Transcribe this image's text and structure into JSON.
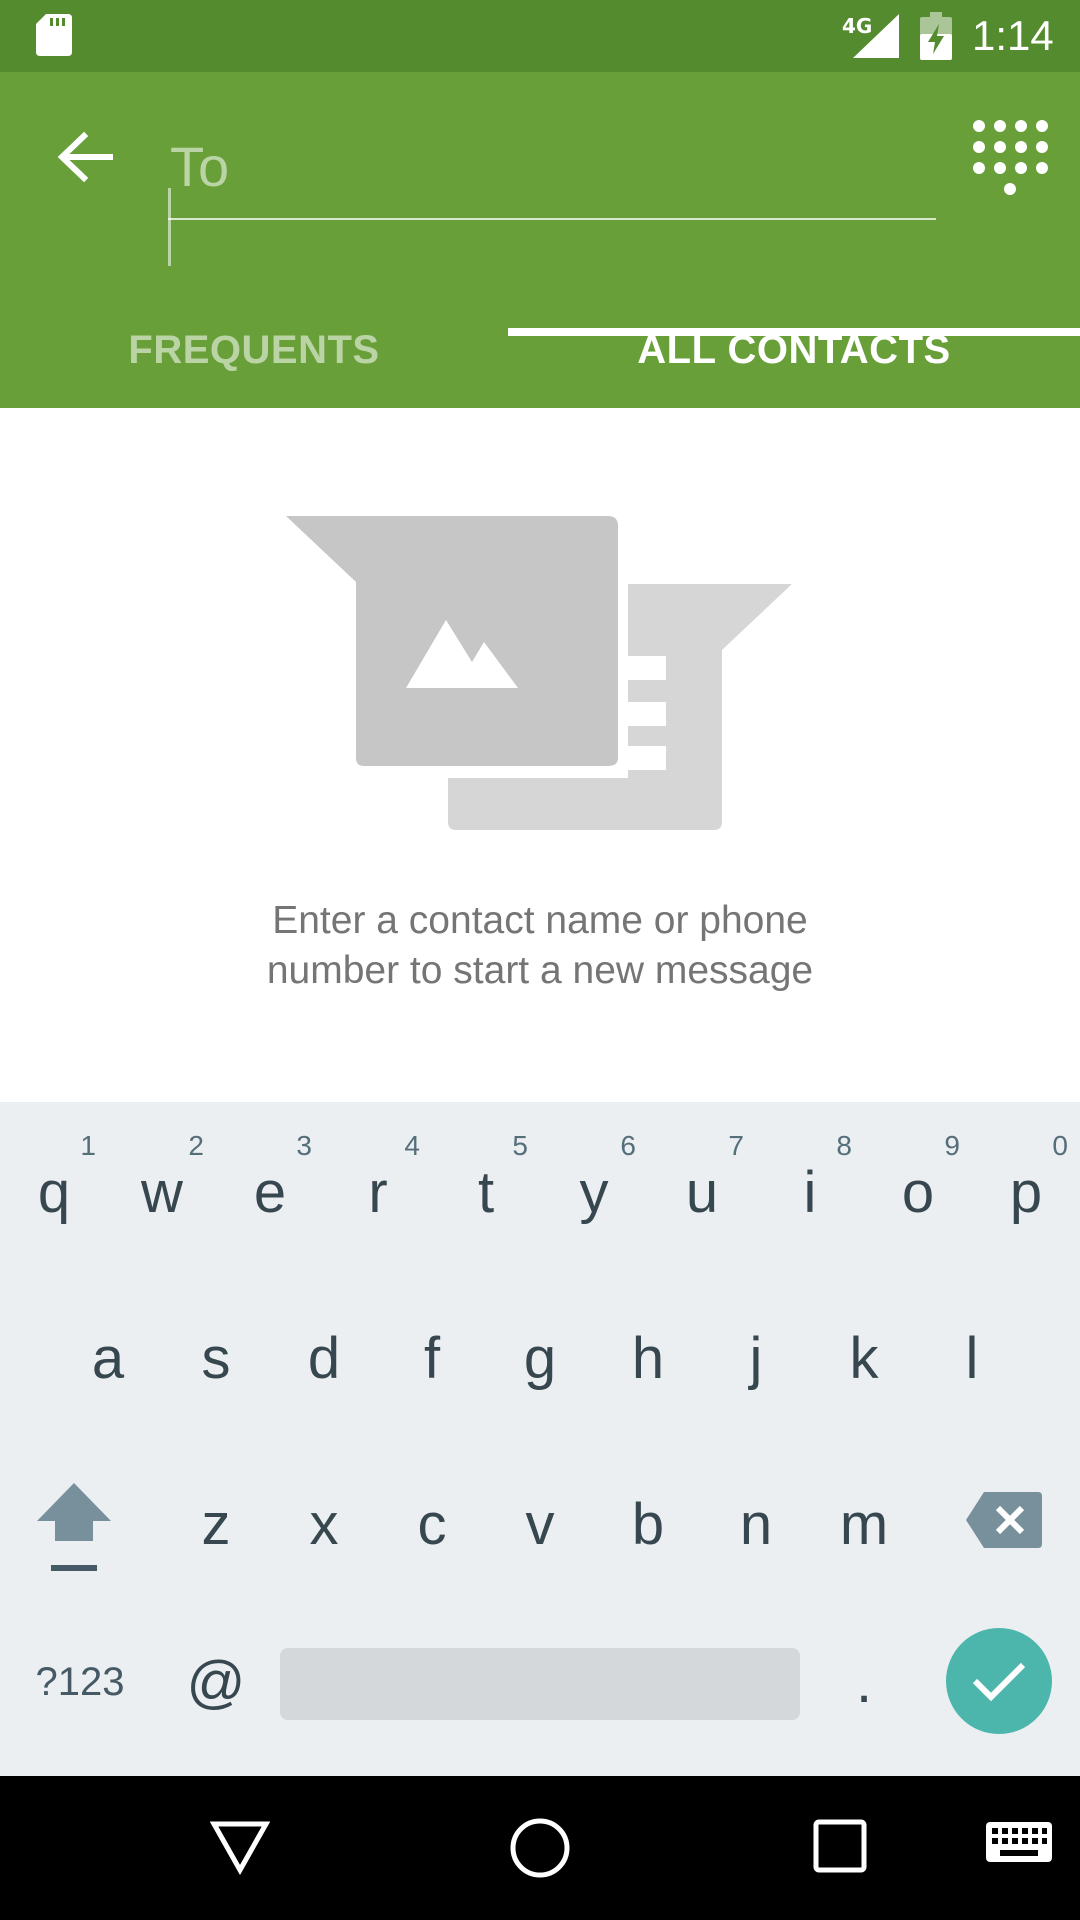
{
  "status_bar": {
    "network_type": "4G",
    "time": "1:14",
    "icons": [
      "sd-card-icon",
      "signal-icon",
      "battery-charging-icon"
    ]
  },
  "app_bar": {
    "back_icon": "arrow-back-icon",
    "to_placeholder": "To",
    "to_value": "",
    "dialpad_icon": "dialpad-icon",
    "background": "#689f38",
    "status_background": "#558b2f"
  },
  "tabs": [
    {
      "label": "FREQUENTS",
      "selected": false
    },
    {
      "label": "ALL CONTACTS",
      "selected": true
    }
  ],
  "empty_state": {
    "icon": "messages-illustration-icon",
    "message_line1": "Enter a contact name or phone",
    "message_line2": "number to start a new message"
  },
  "keyboard": {
    "row1": [
      {
        "key": "q",
        "hint": "1"
      },
      {
        "key": "w",
        "hint": "2"
      },
      {
        "key": "e",
        "hint": "3"
      },
      {
        "key": "r",
        "hint": "4"
      },
      {
        "key": "t",
        "hint": "5"
      },
      {
        "key": "y",
        "hint": "6"
      },
      {
        "key": "u",
        "hint": "7"
      },
      {
        "key": "i",
        "hint": "8"
      },
      {
        "key": "o",
        "hint": "9"
      },
      {
        "key": "p",
        "hint": "0"
      }
    ],
    "row2": [
      "a",
      "s",
      "d",
      "f",
      "g",
      "h",
      "j",
      "k",
      "l"
    ],
    "row3": [
      "z",
      "x",
      "c",
      "v",
      "b",
      "n",
      "m"
    ],
    "symbols_label": "?123",
    "at_label": "@",
    "period_label": ".",
    "shift_icon": "shift-icon",
    "backspace_icon": "backspace-icon",
    "enter_icon": "check-icon",
    "enter_color": "#4db6ac"
  },
  "nav_bar": {
    "icons": [
      "back-triangle-icon",
      "home-circle-icon",
      "recents-square-icon",
      "keyboard-icon"
    ]
  }
}
